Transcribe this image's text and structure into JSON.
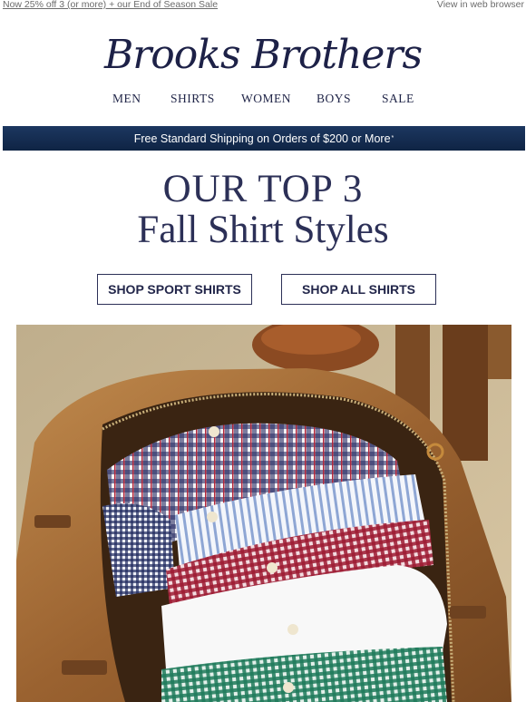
{
  "preheader": {
    "promo_link": "Now 25% off 3 (or more) + our End of Season Sale",
    "web_view": "View in web browser"
  },
  "brand": {
    "logo": "Brooks Brothers"
  },
  "nav": {
    "items": [
      "MEN",
      "SHIRTS",
      "WOMEN",
      "BOYS",
      "SALE"
    ]
  },
  "shipping": {
    "text": "Free Standard Shipping on Orders of $200 or More",
    "marker": "*"
  },
  "hero_text": {
    "line1": "OUR TOP 3",
    "line2": "Fall Shirt Styles"
  },
  "cta": {
    "sport": "SHOP SPORT SHIRTS",
    "all": "SHOP ALL SHIRTS"
  },
  "colors": {
    "navy": "#1d2147",
    "ship_bar": "#143057",
    "leather": "#a26a35",
    "floor": "#cdbb9a"
  },
  "image": {
    "description": "product-photo-duffel-bag-with-shirts"
  }
}
